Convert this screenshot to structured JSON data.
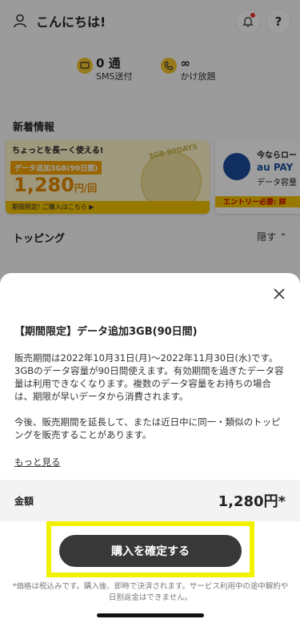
{
  "header": {
    "greeting": "こんにちは!",
    "help_label": "?"
  },
  "usage": [
    {
      "value": "0 通",
      "label": "SMS送付"
    },
    {
      "value": "∞",
      "label": "かけ放題"
    }
  ],
  "news": {
    "title": "新着情報",
    "banner_a": {
      "tagline": "ちょっとを長ーく使える!",
      "tag": "データ追加3GB(90日間)",
      "price": "1,280",
      "unit": "円/回",
      "footer": "期間限定! ご購入はこちら ▶",
      "stamp": "3GB 90DAYS"
    },
    "banner_b": {
      "line1": "今ならロー",
      "line2": "au PAY",
      "line3": "データ容量",
      "footer": "エントリー必要: 詳"
    }
  },
  "topping": {
    "title": "トッピング",
    "hide_label": "隠す"
  },
  "sheet": {
    "title": "【期間限定】データ追加3GB(90日間)",
    "paragraphs": [
      "販売期間は2022年10月31日(月)〜2022年11月30日(水)です。3GBのデータ容量が90日間使えます。有効期間を過ぎたデータ容量は利用できなくなります。複数のデータ容量をお持ちの場合は、期限が早いデータから消費されます。",
      "今後、販売期間を延長して、または近日中に同一・類似のトッピングを販売することがあります。"
    ],
    "more_label": "もっと見る",
    "price_label": "金額",
    "price_value": "1,280円*",
    "confirm_label": "購入を確定する",
    "footnote": "*価格は税込みです。購入後、即時で決済されます。サービス利用中の途中解約や日割返金はできません。"
  },
  "colors": {
    "highlight": "#f2f200",
    "button": "#383838",
    "accent": "#f5c400"
  }
}
